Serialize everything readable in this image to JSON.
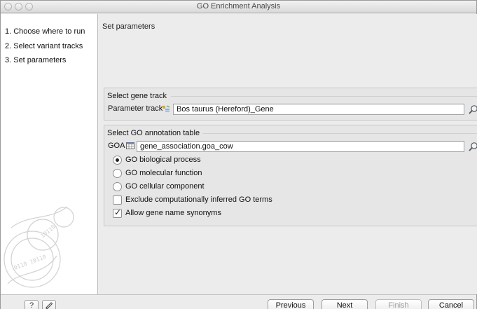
{
  "window": {
    "title": "GO Enrichment Analysis"
  },
  "sidebar": {
    "steps": [
      {
        "label": "1. Choose where to run"
      },
      {
        "label": "2. Select variant tracks"
      },
      {
        "label": "3. Set parameters"
      }
    ]
  },
  "main": {
    "section_title": "Set parameters",
    "gene_track_group": {
      "legend": "Select gene track",
      "field_label": "Parameter track",
      "field_value": "Bos taurus (Hereford)_Gene",
      "icon": "gene-track-icon"
    },
    "go_table_group": {
      "legend": "Select GO annotation table",
      "field_label": "GOA",
      "field_value": "gene_association.goa_cow",
      "icon": "table-icon",
      "options": [
        {
          "type": "radio",
          "label": "GO biological process",
          "checked": true
        },
        {
          "type": "radio",
          "label": "GO molecular function",
          "checked": false
        },
        {
          "type": "radio",
          "label": "GO cellular component",
          "checked": false
        },
        {
          "type": "checkbox",
          "label": "Exclude computationally inferred GO terms",
          "checked": false
        },
        {
          "type": "checkbox",
          "label": "Allow gene name synonyms",
          "checked": true
        }
      ]
    }
  },
  "footer": {
    "help_label": "?",
    "reset_icon": "reset-icon",
    "previous_label": "Previous",
    "next_label": "Next",
    "finish_label": "Finish",
    "cancel_label": "Cancel"
  }
}
